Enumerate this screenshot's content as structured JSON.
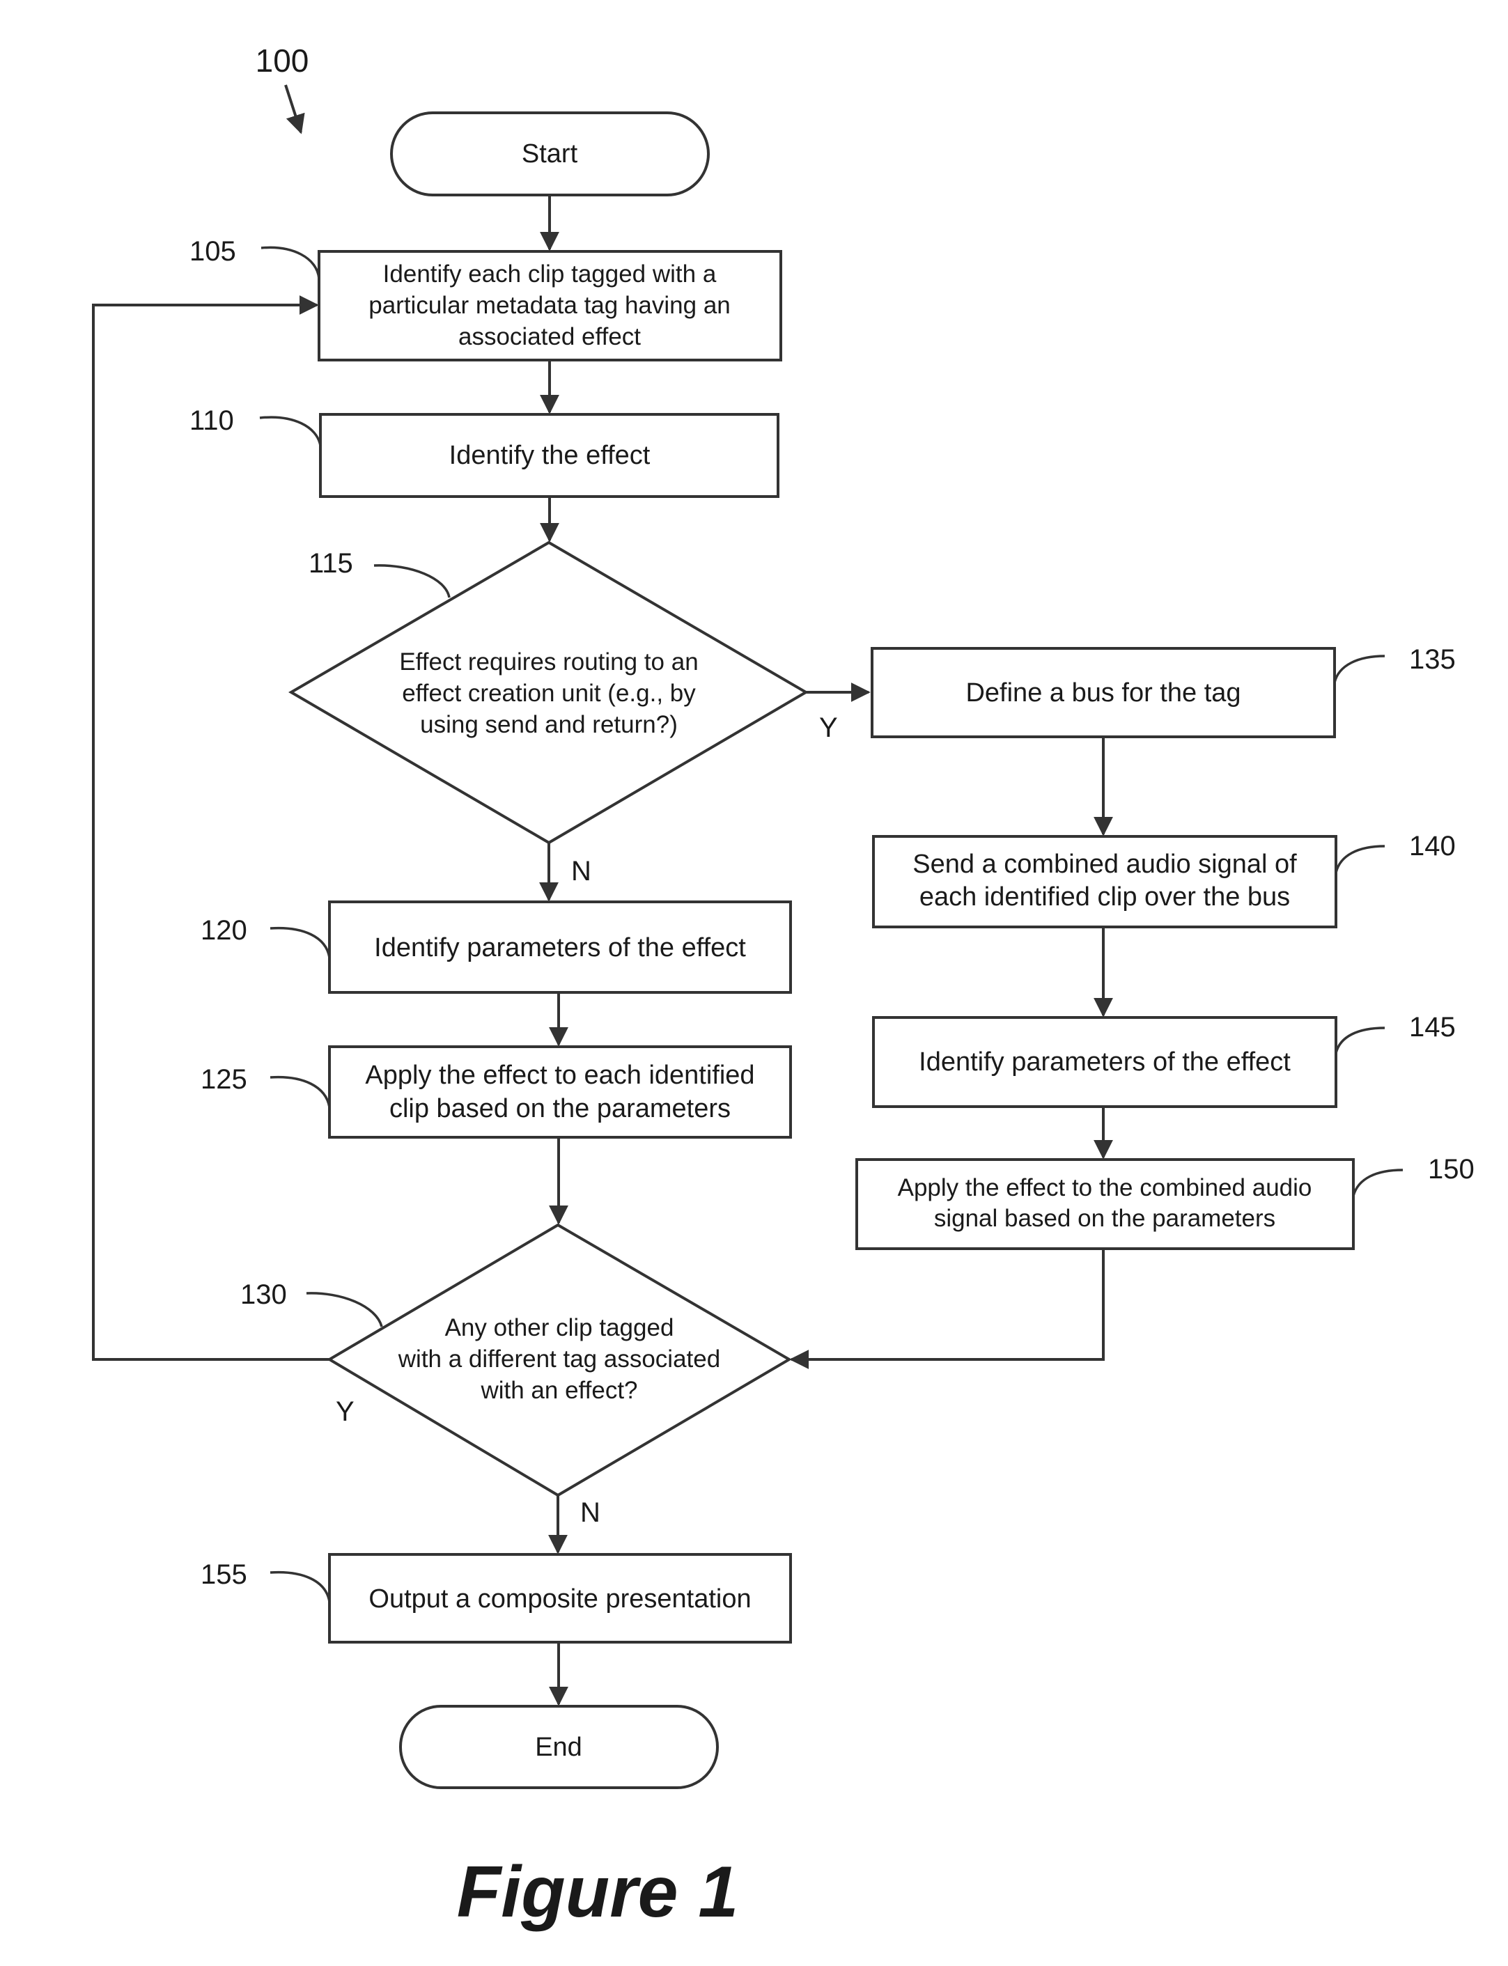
{
  "figure": {
    "title": "Figure 1",
    "reference": "100"
  },
  "nodes": {
    "start": {
      "label": "Start"
    },
    "n105": {
      "ref": "105",
      "lines": [
        "Identify each clip tagged with a",
        "particular metadata tag having an",
        "associated effect"
      ]
    },
    "n110": {
      "ref": "110",
      "lines": [
        "Identify the effect"
      ]
    },
    "n115": {
      "ref": "115",
      "lines": [
        "Effect requires routing to an",
        "effect creation unit (e.g., by",
        "using send and return?)"
      ]
    },
    "n120": {
      "ref": "120",
      "lines": [
        "Identify parameters of the effect"
      ]
    },
    "n125": {
      "ref": "125",
      "lines": [
        "Apply the effect to each identified",
        "clip based on the parameters"
      ]
    },
    "n130": {
      "ref": "130",
      "lines": [
        "Any other clip tagged",
        "with a different tag associated",
        "with an effect?"
      ]
    },
    "n135": {
      "ref": "135",
      "lines": [
        "Define a bus for the tag"
      ]
    },
    "n140": {
      "ref": "140",
      "lines": [
        "Send a combined audio signal of",
        "each identified clip over the bus"
      ]
    },
    "n145": {
      "ref": "145",
      "lines": [
        "Identify parameters of the effect"
      ]
    },
    "n150": {
      "ref": "150",
      "lines": [
        "Apply the effect to the combined audio",
        "signal based on the parameters"
      ]
    },
    "n155": {
      "ref": "155",
      "lines": [
        "Output a composite presentation"
      ]
    },
    "end": {
      "label": "End"
    }
  },
  "branch_labels": {
    "d115_yes": "Y",
    "d115_no": "N",
    "d130_yes": "Y",
    "d130_no": "N"
  }
}
